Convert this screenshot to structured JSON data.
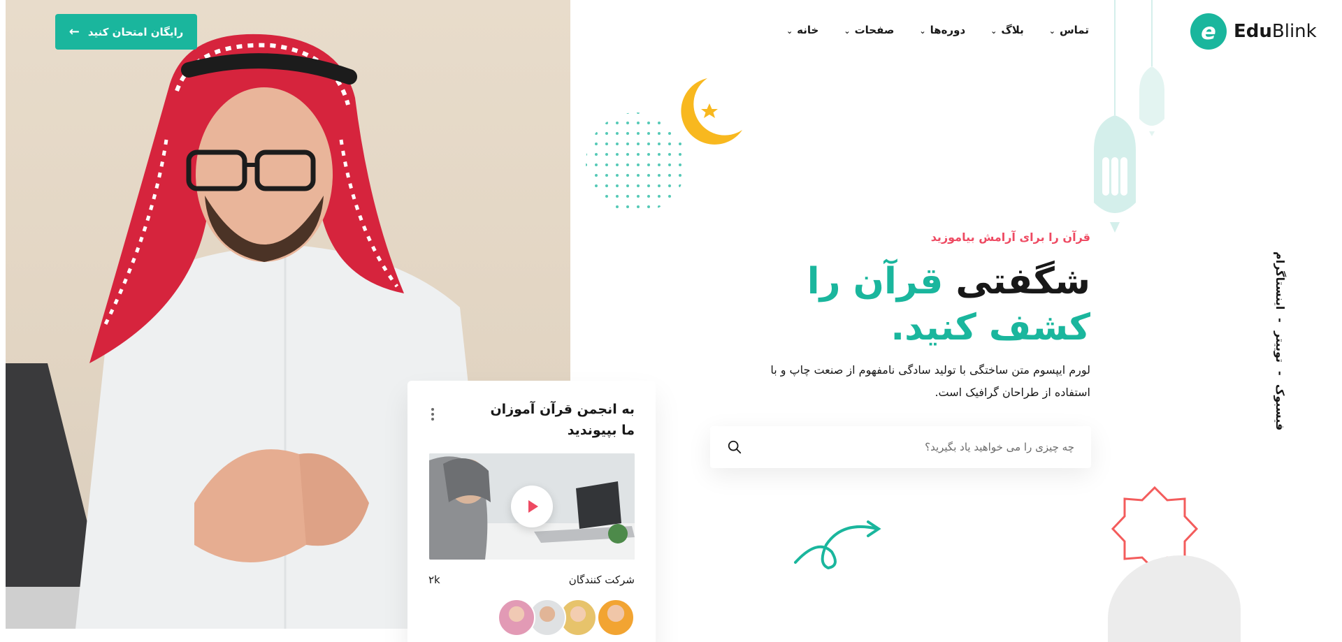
{
  "header": {
    "logo": {
      "mark": "e",
      "text_bold": "Edu",
      "text_regular": "Blink"
    },
    "nav": [
      {
        "label": "خانه"
      },
      {
        "label": "صفحات"
      },
      {
        "label": "دوره‌ها"
      },
      {
        "label": "بلاگ"
      },
      {
        "label": "تماس"
      }
    ],
    "cta_label": "رایگان امتحان کنید"
  },
  "hero": {
    "subtitle": "قرآن را برای آرامش بیاموزید",
    "headline_plain": "شگفتی",
    "headline_accent": "قرآن را کشف کنید.",
    "description": "لورم ایپسوم متن ساختگی با تولید سادگی نامفهوم از صنعت چاپ و با استفاده از طراحان گرافیک است.",
    "search": {
      "placeholder": "چه چیزی را می خواهید یاد بگیرید؟"
    }
  },
  "community_card": {
    "title": "به انجمن قرآن آموزان ما بپیوندید",
    "participants_label": "شرکت کنندگان",
    "participants_count": "۲k",
    "avatar_count": 4
  },
  "social": {
    "items": [
      "فیسبوک",
      "توییتر",
      "اینستاگرام"
    ],
    "separator": "-"
  },
  "colors": {
    "primary": "#1ab69d",
    "accent_red": "#ee4a62",
    "moon": "#f8b81f",
    "text": "#181818"
  },
  "icons": [
    "arrow-left-icon",
    "chevron-down-icon",
    "search-icon",
    "play-icon",
    "kebab-menu-icon",
    "crescent-moon-icon",
    "star-icon",
    "lantern-icon"
  ]
}
